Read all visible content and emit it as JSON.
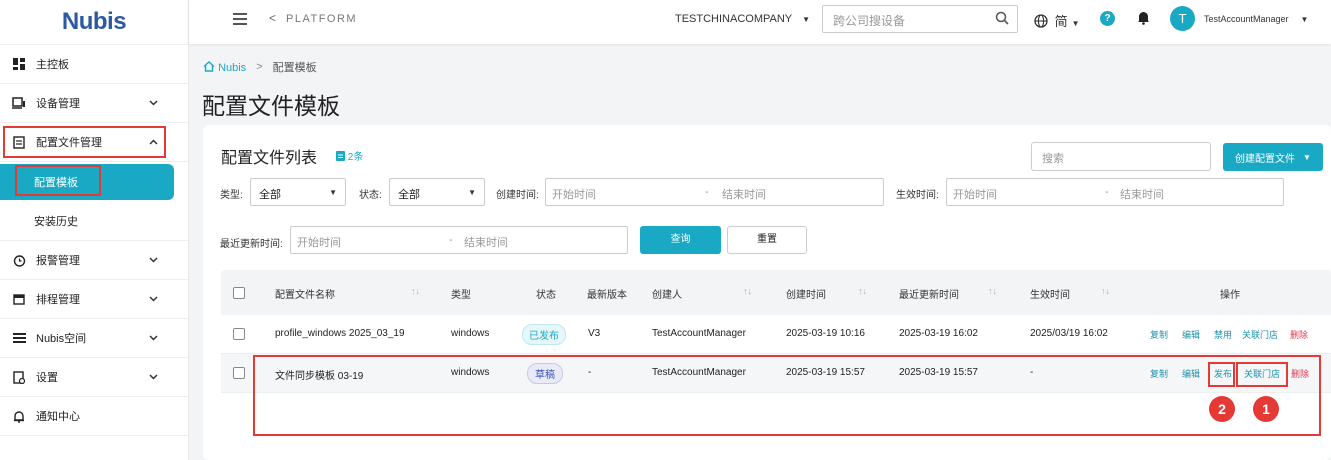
{
  "logo": {
    "text": "Nubis"
  },
  "sidebar": {
    "items": [
      {
        "label": "主控板",
        "icon": "dashboard-icon"
      },
      {
        "label": "设备管理",
        "icon": "device-icon"
      },
      {
        "label": "配置文件管理",
        "icon": "config-file-icon"
      },
      {
        "label": "配置模板",
        "sub": true
      },
      {
        "label": "安装历史",
        "sub": true
      },
      {
        "label": "报警管理",
        "icon": "alarm-clock-icon"
      },
      {
        "label": "排程管理",
        "icon": "calendar-icon"
      },
      {
        "label": "Nubis空间",
        "icon": "list-icon"
      },
      {
        "label": "设置",
        "icon": "settings-icon"
      },
      {
        "label": "通知中心",
        "icon": "bell-icon"
      }
    ]
  },
  "header": {
    "back": "<",
    "platform": "PLATFORM",
    "company": "TESTCHINACOMPANY",
    "search_placeholder": "跨公司搜设备",
    "lang": "简",
    "help": "?",
    "avatar_letter": "T",
    "username": "TestAccountManager"
  },
  "breadcrumb": {
    "home": "Nubis",
    "sep": ">",
    "current": "配置模板"
  },
  "page_title": "配置文件模板",
  "card": {
    "title": "配置文件列表",
    "count": "2条",
    "search_placeholder": "搜索",
    "create_label": "创建配置文件"
  },
  "filters": {
    "type_label": "类型:",
    "type_value": "全部",
    "status_label": "状态:",
    "status_value": "全部",
    "created_label": "创建时间:",
    "effective_label": "生效时间:",
    "updated_label": "最近更新时间:",
    "start": "开始时间",
    "end": "结束时间",
    "dash": "-",
    "query": "查询",
    "reset": "重置"
  },
  "table": {
    "headers": [
      "配置文件名称",
      "类型",
      "状态",
      "最新版本",
      "创建人",
      "创建时间",
      "最近更新时间",
      "生效时间",
      "操作"
    ],
    "rows": [
      {
        "name": "profile_windows 2025_03_19",
        "type": "windows",
        "status": "已发布",
        "version": "V3",
        "creator": "TestAccountManager",
        "created": "2025-03-19 10:16",
        "updated": "2025-03-19 16:02",
        "effective": "2025/03/19 16:02",
        "actions": [
          "复制",
          "编辑",
          "禁用",
          "关联门店",
          "删除"
        ]
      },
      {
        "name": "文件同步模板 03-19",
        "type": "windows",
        "status": "草稿",
        "version": "-",
        "creator": "TestAccountManager",
        "created": "2025-03-19 15:57",
        "updated": "2025-03-19 15:57",
        "effective": "-",
        "actions": [
          "复制",
          "编辑",
          "发布",
          "关联门店",
          "删除"
        ]
      }
    ]
  },
  "annotations": {
    "badge1": "1",
    "badge2": "2"
  },
  "colors": {
    "accent": "#1aa9c4",
    "highlight": "#e53935",
    "delete": "#e53950"
  }
}
